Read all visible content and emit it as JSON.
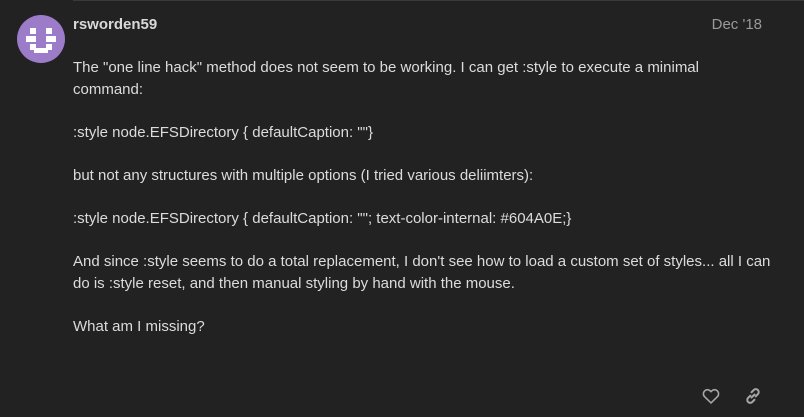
{
  "post": {
    "author": "rsworden59",
    "date": "Dec '18",
    "paragraphs": [
      "The \"one line hack\" method does not seem to be working. I can get :style to execute a minimal command:",
      ":style node.EFSDirectory { defaultCaption: \"\"}",
      "but not any structures with multiple options (I tried various deliimters):",
      ":style node.EFSDirectory { defaultCaption: \"\"; text-color-internal: #604A0E;}",
      "And since :style seems to do a total replacement, I don't see how to load a custom set of styles... all I can do is :style reset, and then manual styling by hand with the mouse.",
      "What am I missing?"
    ]
  },
  "actions": {
    "like_icon": "heart-icon",
    "link_icon": "link-icon"
  },
  "colors": {
    "background": "#222222",
    "avatar": "#9c7cc9",
    "text": "#dcdcdc",
    "muted": "#9a9a9a"
  }
}
